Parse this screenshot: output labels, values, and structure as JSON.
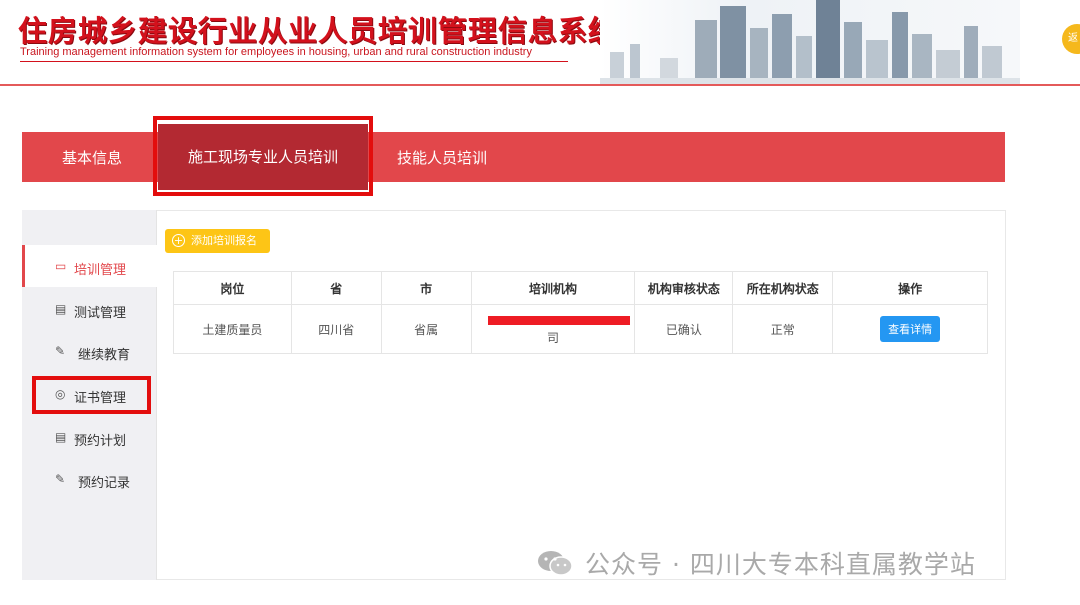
{
  "header": {
    "title": "住房城乡建设行业从业人员培训管理信息系统",
    "subtitle": "Training management information system for employees in housing, urban and rural construction industry",
    "back_label": "返"
  },
  "topnav": {
    "items": [
      {
        "label": "基本信息"
      },
      {
        "label": "施工现场专业人员培训",
        "active": true
      },
      {
        "label": "技能人员培训"
      }
    ]
  },
  "sidebar": {
    "items": [
      {
        "label": "培训管理",
        "icon": "message-icon",
        "active": true
      },
      {
        "label": "测试管理",
        "icon": "clipboard-icon"
      },
      {
        "label": "继续教育",
        "icon": "edit-icon"
      },
      {
        "label": "证书管理",
        "icon": "badge-icon"
      },
      {
        "label": "预约计划",
        "icon": "clipboard-icon"
      },
      {
        "label": "预约记录",
        "icon": "edit-icon"
      }
    ]
  },
  "main": {
    "add_button": "添加培训报名",
    "table": {
      "headers": [
        "岗位",
        "省",
        "市",
        "培训机构",
        "机构审核状态",
        "所在机构状态",
        "操作"
      ],
      "rows": [
        {
          "position": "土建质量员",
          "province": "四川省",
          "city": "省属",
          "org_visible_tail": "司",
          "review_status": "已确认",
          "org_status": "正常",
          "action": "查看详情"
        }
      ]
    }
  },
  "watermark": "公众号 · 四川大专本科直属教学站",
  "colors": {
    "brand_red": "#e2474b",
    "active_tab": "#b32932",
    "title_red": "#d3111c",
    "add_yellow": "#fdc516",
    "detail_blue": "#2497f2",
    "highlight_box": "#e30d0d"
  }
}
